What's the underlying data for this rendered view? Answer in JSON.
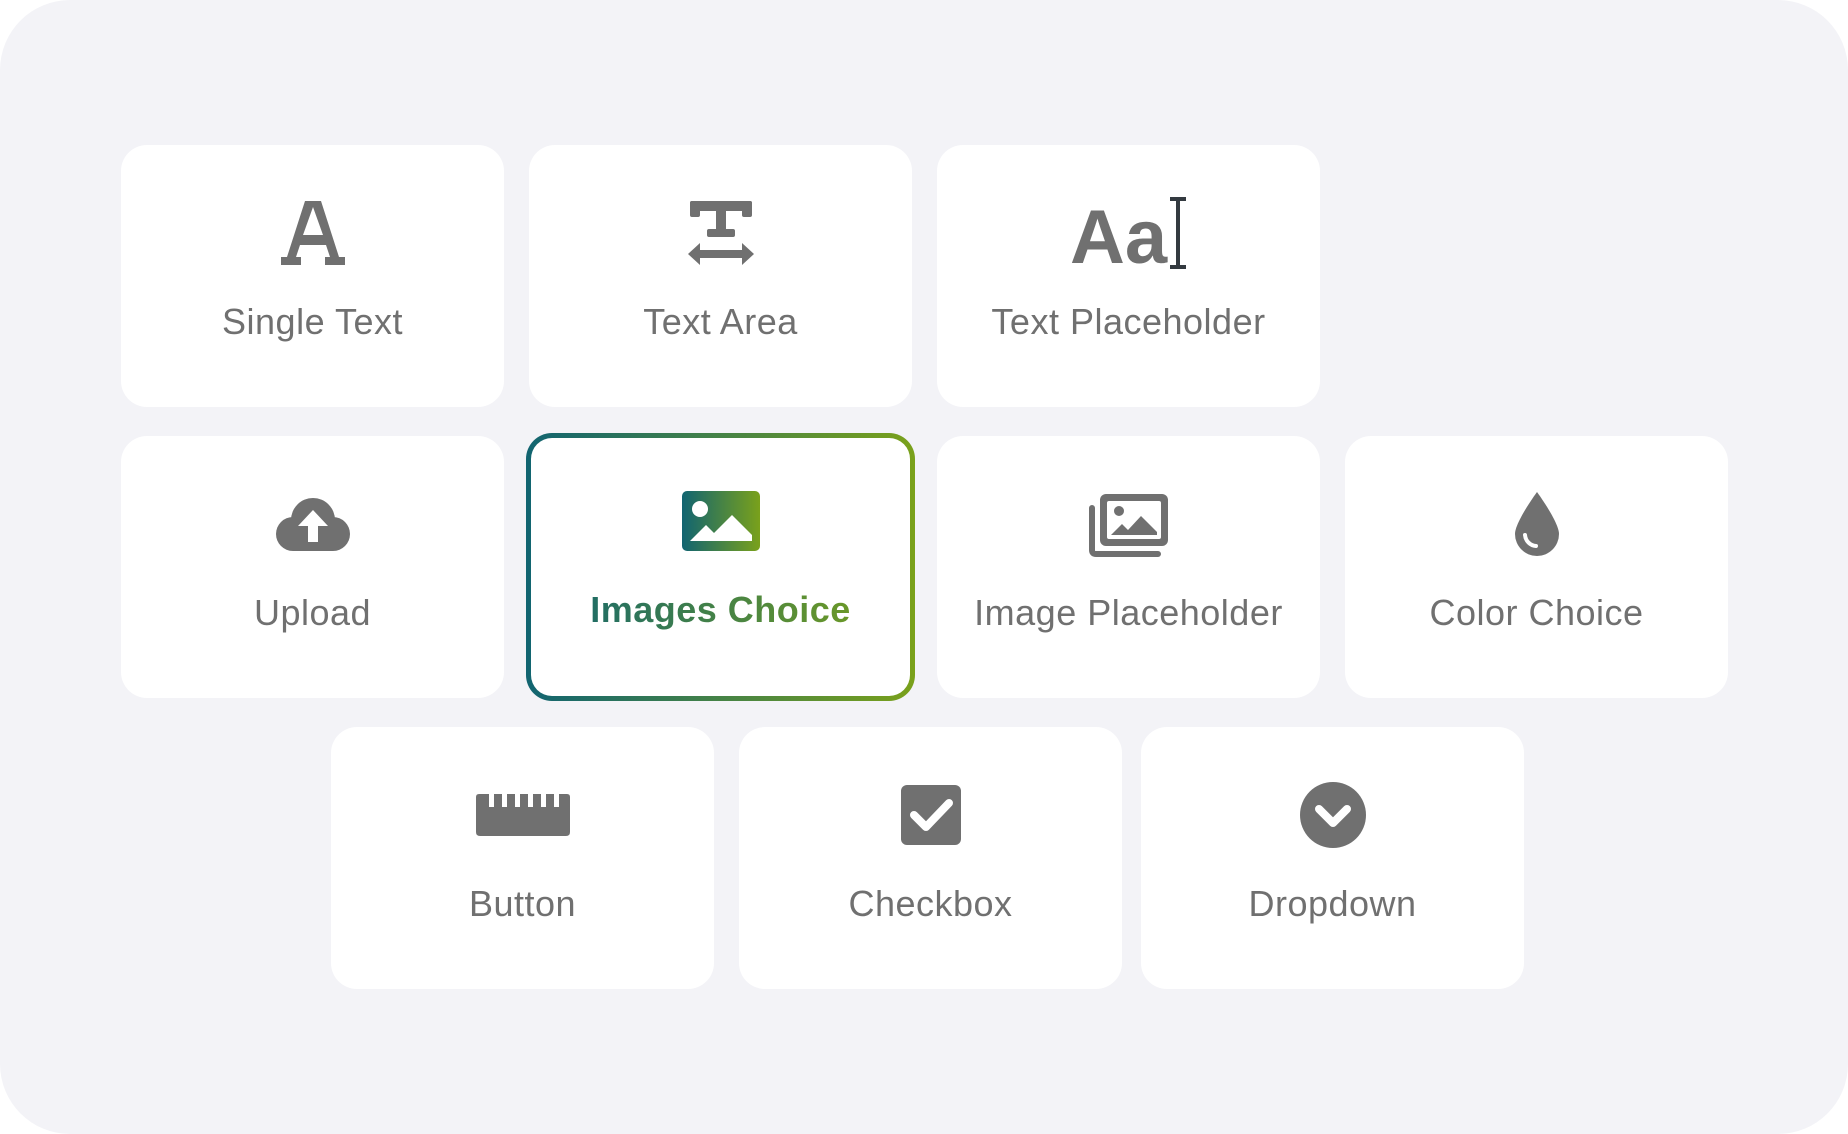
{
  "widget_picker": {
    "items": [
      {
        "id": "single-text",
        "label": "Single Text",
        "icon": "letter-a-icon",
        "selected": false
      },
      {
        "id": "text-area",
        "label": "Text Area",
        "icon": "text-width-icon",
        "selected": false
      },
      {
        "id": "text-placeholder",
        "label": "Text Placeholder",
        "icon": "text-cursor-icon",
        "icon_text": "Aa",
        "selected": false
      },
      {
        "id": "upload",
        "label": "Upload",
        "icon": "cloud-upload-icon",
        "selected": false
      },
      {
        "id": "images-choice",
        "label": "Images Choice",
        "icon": "image-icon",
        "selected": true
      },
      {
        "id": "image-placeholder",
        "label": "Image Placeholder",
        "icon": "images-stack-icon",
        "selected": false
      },
      {
        "id": "color-choice",
        "label": "Color Choice",
        "icon": "droplet-icon",
        "selected": false
      },
      {
        "id": "button",
        "label": "Button",
        "icon": "ruler-icon",
        "selected": false
      },
      {
        "id": "checkbox",
        "label": "Checkbox",
        "icon": "checkbox-icon",
        "selected": false
      },
      {
        "id": "dropdown",
        "label": "Dropdown",
        "icon": "chevron-circle-down-icon",
        "selected": false
      }
    ]
  },
  "colors": {
    "panel_background": "#f3f3f7",
    "card_background": "#ffffff",
    "icon_gray": "#707070",
    "label_gray": "#707070",
    "selected_gradient_start": "#116471",
    "selected_gradient_end": "#7aa11b"
  }
}
